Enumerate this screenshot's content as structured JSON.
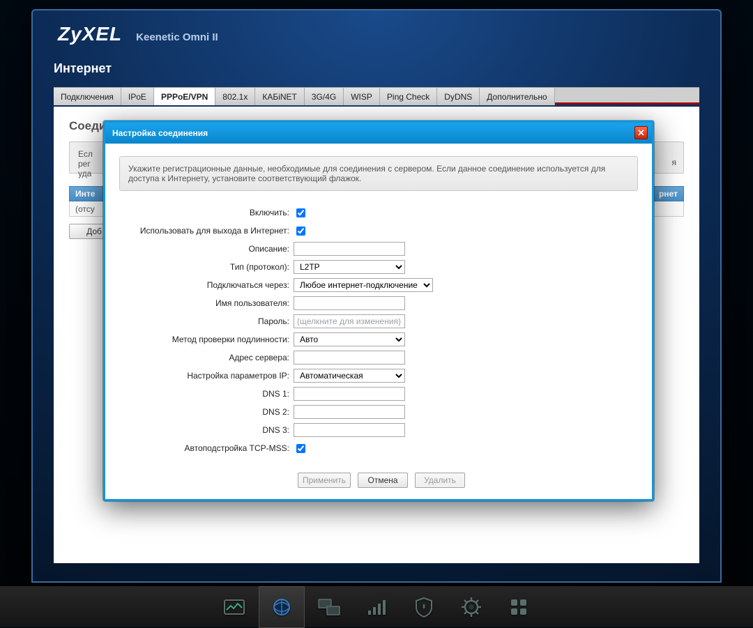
{
  "brand": "ZyXEL",
  "model": "Keenetic Omni II",
  "pageTitle": "Интернет",
  "tabs": [
    "Подключения",
    "IPoE",
    "PPPoE/VPN",
    "802.1x",
    "КАБiNET",
    "3G/4G",
    "WISP",
    "Ping Check",
    "DyDNS",
    "Дополнительно"
  ],
  "activeTab": 2,
  "section": {
    "title": "Соединения с авторизацией (PPP)",
    "hint_prefix": "Есл",
    "hint_line2": "рег",
    "hint_line3": "уда",
    "hint_tail": "я",
    "tableHeaderLeft": "Инте",
    "tableHeaderRight": "рнет",
    "rowText": "(отсу",
    "addButtonLabel": "Доб"
  },
  "dialog": {
    "title": "Настройка соединения",
    "hint": "Укажите регистрационные данные, необходимые для соединения с сервером. Если данное соединение используется для доступа к Интернету, установите соответствующий флажок.",
    "labels": {
      "enable": "Включить:",
      "useInternet": "Использовать для выхода в Интернет:",
      "description": "Описание:",
      "proto": "Тип (протокол):",
      "connectVia": "Подключаться через:",
      "username": "Имя пользователя:",
      "password": "Пароль:",
      "auth": "Метод проверки подлинности:",
      "server": "Адрес сервера:",
      "ipConf": "Настройка параметров IP:",
      "dns1": "DNS 1:",
      "dns2": "DNS 2:",
      "dns3": "DNS 3:",
      "tcpmss": "Автоподстройка TCP-MSS:"
    },
    "values": {
      "enable": true,
      "useInternet": true,
      "description": "",
      "proto": "L2TP",
      "connectVia": "Любое интернет-подключение",
      "username": "",
      "passwordPlaceholder": "(щелкните для изменения)",
      "auth": "Авто",
      "server": "",
      "ipConf": "Автоматическая",
      "dns1": "",
      "dns2": "",
      "dns3": "",
      "tcpmss": true
    },
    "buttons": {
      "apply": "Применить",
      "cancel": "Отмена",
      "delete": "Удалить"
    }
  },
  "dockActive": 1
}
